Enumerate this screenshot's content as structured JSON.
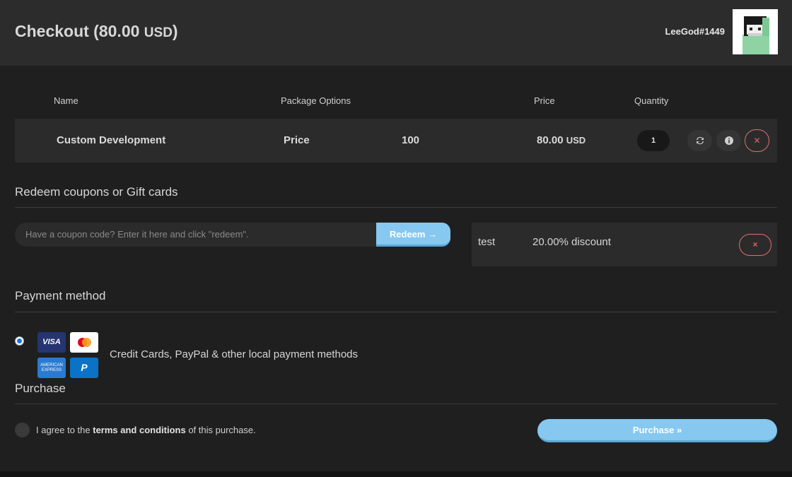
{
  "header": {
    "title_prefix": "Checkout (",
    "title_amount": "80.00",
    "title_currency": "USD",
    "title_suffix": ")",
    "username": "LeeGod#1449"
  },
  "table": {
    "columns": [
      "Name",
      "Package Options",
      "Price",
      "Quantity"
    ],
    "rows": [
      {
        "name": "Custom Development",
        "option_label": "Price",
        "option_value": "100",
        "price": "80.00",
        "currency": "USD",
        "quantity": "1",
        "actions": [
          "refresh-icon",
          "info-icon",
          "close-icon"
        ]
      }
    ]
  },
  "coupons": {
    "section_title": "Redeem coupons or Gift cards",
    "placeholder": "Have a coupon code? Enter it here and click \"redeem\".",
    "redeem_label": "Redeem",
    "redeem_icon": "→",
    "applied": [
      {
        "code": "test",
        "discount": "20.00% discount",
        "remove_icon": "×"
      }
    ]
  },
  "payment": {
    "section_title": "Payment method",
    "method_label": "Credit Cards, PayPal & other local payment methods",
    "card_icons": [
      "visa-icon",
      "mastercard-icon",
      "amex-icon",
      "paypal-icon"
    ],
    "visa_text": "VISA",
    "amex_text": "AMERICAN EXPRESS",
    "paypal_text": "P"
  },
  "purchase": {
    "section_title": "Purchase",
    "terms_prefix": "I agree to the ",
    "terms_link": "terms and conditions",
    "terms_suffix": " of this purchase.",
    "button_label": "Purchase »"
  },
  "colors": {
    "accent": "#86c8f0",
    "danger": "#e06464",
    "background": "#1f1f1f"
  }
}
